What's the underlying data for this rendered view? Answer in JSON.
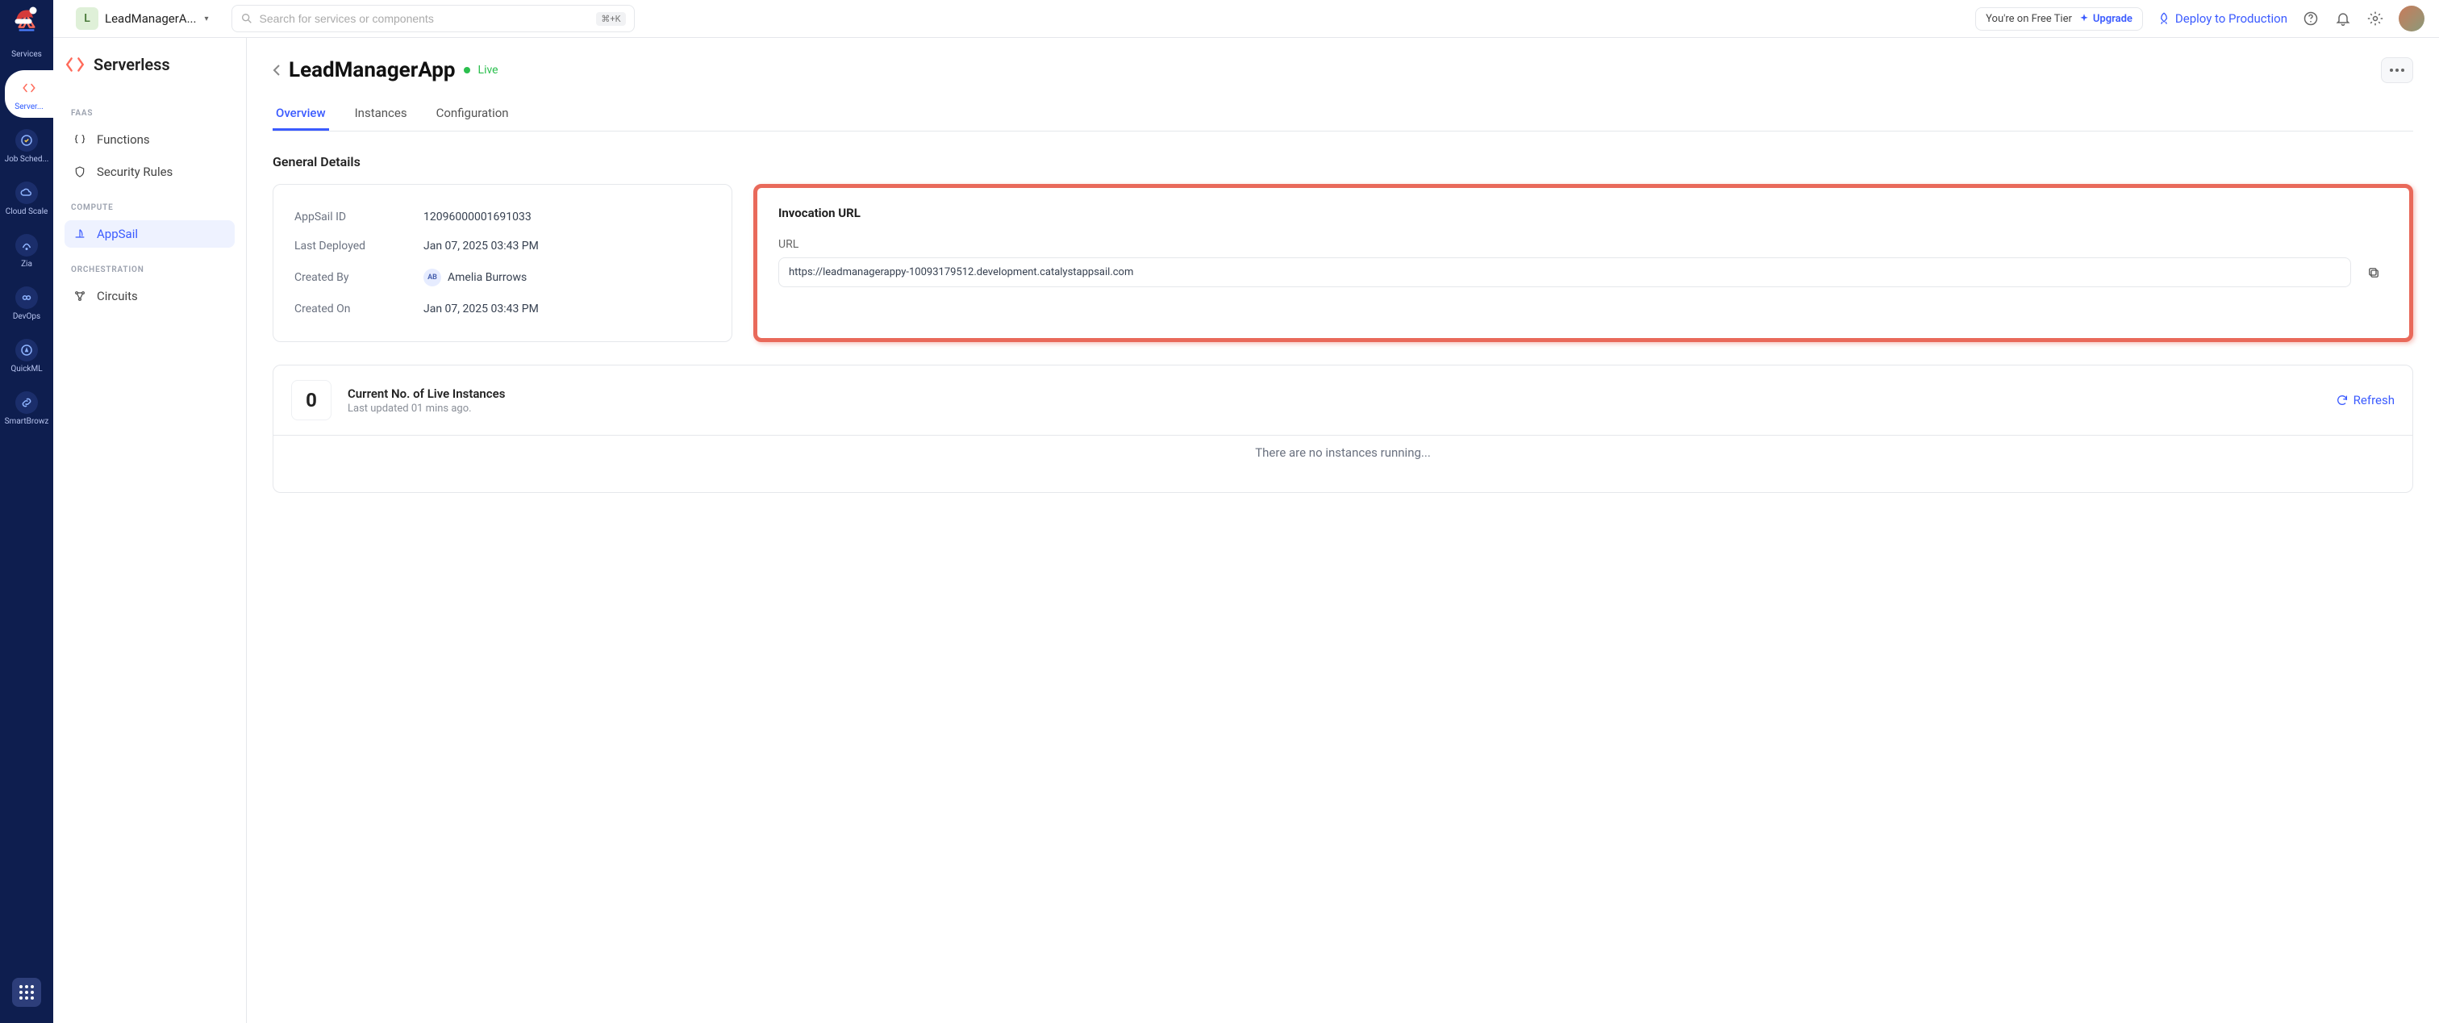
{
  "rail": {
    "items": [
      {
        "label": "Services"
      },
      {
        "label": "Server..."
      },
      {
        "label": "Job Sched..."
      },
      {
        "label": "Cloud Scale"
      },
      {
        "label": "Zia"
      },
      {
        "label": "DevOps"
      },
      {
        "label": "QuickML"
      },
      {
        "label": "SmartBrowz"
      }
    ]
  },
  "topbar": {
    "project_initial": "L",
    "project_name": "LeadManagerA...",
    "search_placeholder": "Search for services or components",
    "search_shortcut": "⌘+K",
    "tier_label": "You're on Free Tier",
    "upgrade_label": "Upgrade",
    "deploy_label": "Deploy to Production"
  },
  "sidebar": {
    "title": "Serverless",
    "sections": {
      "faas": "FAAS",
      "compute": "COMPUTE",
      "orchestration": "ORCHESTRATION"
    },
    "items": {
      "functions": "Functions",
      "security": "Security Rules",
      "appsail": "AppSail",
      "circuits": "Circuits"
    }
  },
  "page": {
    "title": "LeadManagerApp",
    "status": "Live",
    "tabs": [
      "Overview",
      "Instances",
      "Configuration"
    ],
    "general_heading": "General Details",
    "details": {
      "appsail_id_label": "AppSail ID",
      "appsail_id_value": "12096000001691033",
      "last_deployed_label": "Last Deployed",
      "last_deployed_value": "Jan 07, 2025 03:43 PM",
      "created_by_label": "Created By",
      "created_by_initials": "AB",
      "created_by_value": "Amelia Burrows",
      "created_on_label": "Created On",
      "created_on_value": "Jan 07, 2025 03:43 PM"
    },
    "invocation": {
      "heading": "Invocation URL",
      "url_label": "URL",
      "url_value": "https://leadmanagerappy-10093179512.development.catalystappsail.com"
    },
    "instances": {
      "count": "0",
      "title": "Current No. of Live Instances",
      "updated": "Last updated 01 mins ago.",
      "refresh": "Refresh",
      "empty": "There are no instances running..."
    }
  }
}
